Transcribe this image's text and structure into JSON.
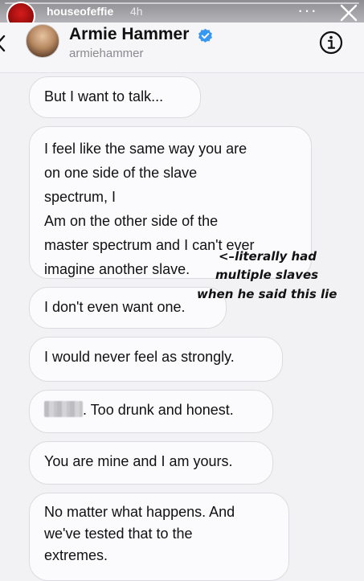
{
  "story": {
    "username": "houseofeffie",
    "time": "4h",
    "more_label": "···"
  },
  "header": {
    "name": "Armie Hammer",
    "handle": "armiehammer"
  },
  "messages": [
    {
      "text": "But I want to talk..."
    },
    {
      "text": "I feel like the same way you are\non one side of the slave\nspectrum, I\n Am on the other side of the\nmaster spectrum and I can't ever\nimagine another slave."
    },
    {
      "text": "I don't even want one."
    },
    {
      "text": "I would never feel as strongly."
    },
    {
      "redacted": true,
      "text": ". Too drunk and honest."
    },
    {
      "text": "You are mine and I am yours."
    },
    {
      "text": "No matter what happens. And\nwe've tested that to the\nextremes."
    }
  ],
  "annotation": {
    "line1": "<–literally had",
    "line2": "multiple slaves",
    "line3": "when he said this lie"
  },
  "colors": {
    "verified_blue": "#3897f0",
    "bubble_bg": "#fbfbfd",
    "bubble_border": "#dcdce0"
  },
  "icons": {
    "close": "close-icon",
    "verified": "verified-badge-icon",
    "info": "info-icon",
    "back": "chevron-left-icon"
  }
}
